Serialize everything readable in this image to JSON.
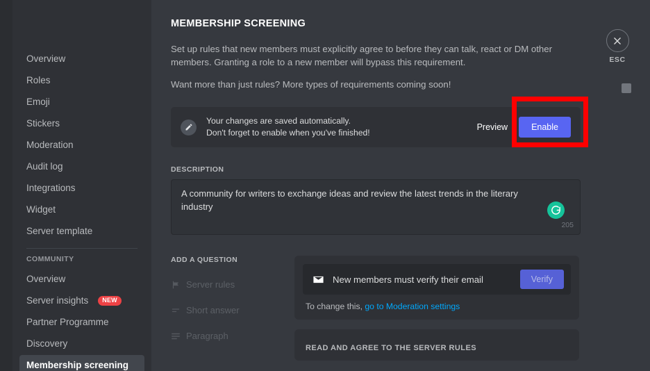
{
  "sidebar": {
    "items": [
      {
        "label": "Overview",
        "active": false,
        "badge": null
      },
      {
        "label": "Roles",
        "active": false,
        "badge": null
      },
      {
        "label": "Emoji",
        "active": false,
        "badge": null
      },
      {
        "label": "Stickers",
        "active": false,
        "badge": null
      },
      {
        "label": "Moderation",
        "active": false,
        "badge": null
      },
      {
        "label": "Audit log",
        "active": false,
        "badge": null
      },
      {
        "label": "Integrations",
        "active": false,
        "badge": null
      },
      {
        "label": "Widget",
        "active": false,
        "badge": null
      },
      {
        "label": "Server template",
        "active": false,
        "badge": null
      }
    ],
    "community_header": "Community",
    "community_items": [
      {
        "label": "Overview",
        "active": false,
        "badge": null
      },
      {
        "label": "Server insights",
        "active": false,
        "badge": "NEW"
      },
      {
        "label": "Partner Programme",
        "active": false,
        "badge": null
      },
      {
        "label": "Discovery",
        "active": false,
        "badge": null
      },
      {
        "label": "Membership screening",
        "active": true,
        "badge": null
      }
    ]
  },
  "main": {
    "title": "Membership Screening",
    "intro_line1": "Set up rules that new members must explicitly agree to before they can talk, react or DM other members. Granting a role to a new member will bypass this requirement.",
    "intro_line2": "Want more than just rules? More types of requirements coming soon!",
    "savebar": {
      "icon": "pencil-icon",
      "line1": "Your changes are saved automatically.",
      "line2": "Don't forget to enable when you've finished!",
      "preview_label": "Preview",
      "enable_label": "Enable"
    },
    "description": {
      "label": "Description",
      "value": "A community for writers to exchange ideas and review the latest trends in the literary industry",
      "char_count": "205",
      "assistant_icon": "grammarly-icon"
    },
    "add_question": {
      "label": "Add a question",
      "types": [
        {
          "label": "Server rules",
          "icon": "flag-icon"
        },
        {
          "label": "Short answer",
          "icon": "short-answer-icon"
        },
        {
          "label": "Paragraph",
          "icon": "paragraph-icon"
        }
      ]
    },
    "verify_card": {
      "icon": "mail-icon",
      "label": "New members must verify their email",
      "button_label": "Verify",
      "note_prefix": "To change this, ",
      "note_link": "go to Moderation settings"
    },
    "rules_card": {
      "title": "Read and agree to the server rules"
    }
  },
  "close": {
    "icon": "close-icon",
    "label": "ESC"
  },
  "colors": {
    "accent_blurple": "#5865f2",
    "link_blue": "#00a8fc",
    "badge_red": "#ed4245",
    "annotation_red": "#ff0000",
    "grammarly_green": "#15c39a",
    "sidebar_bg": "#2f3136",
    "content_bg": "#36393f"
  }
}
